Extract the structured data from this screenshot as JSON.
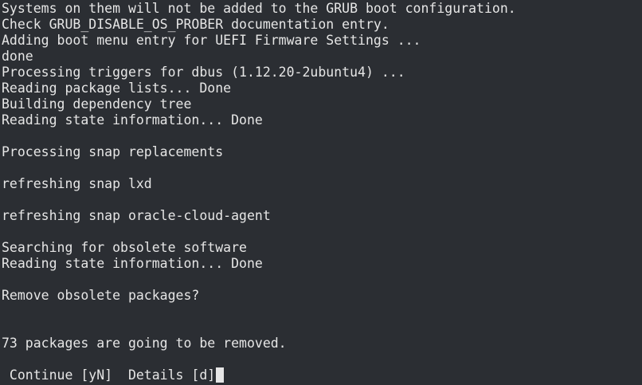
{
  "terminal": {
    "lines": [
      "Systems on them will not be added to the GRUB boot configuration.",
      "Check GRUB_DISABLE_OS_PROBER documentation entry.",
      "Adding boot menu entry for UEFI Firmware Settings ...",
      "done",
      "Processing triggers for dbus (1.12.20-2ubuntu4) ...",
      "Reading package lists... Done",
      "Building dependency tree",
      "Reading state information... Done",
      "",
      "Processing snap replacements",
      "",
      "refreshing snap lxd",
      "",
      "refreshing snap oracle-cloud-agent",
      "",
      "Searching for obsolete software",
      "Reading state information... Done",
      "",
      "Remove obsolete packages?",
      "",
      "",
      "73 packages are going to be removed.",
      ""
    ],
    "prompt": " Continue [yN]  Details [d]"
  },
  "colors": {
    "background": "#2b2e33",
    "foreground": "#e6e6e6"
  }
}
